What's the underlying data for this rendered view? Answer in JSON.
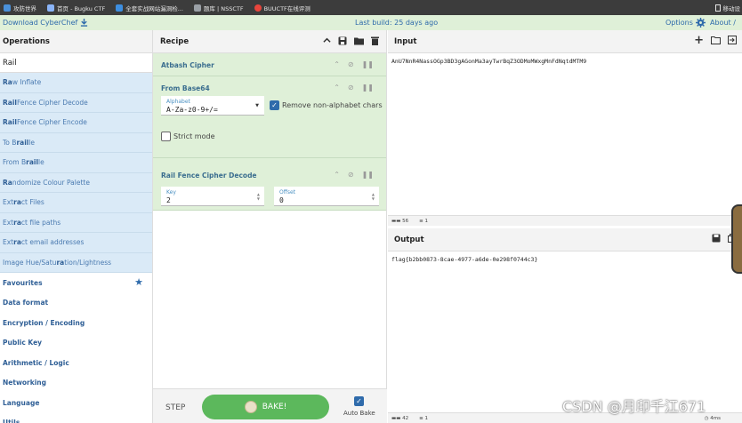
{
  "bookmarks": [
    {
      "label": "攻防世界",
      "icon": "globe-icon",
      "color": "#4a90d9"
    },
    {
      "label": "首页 - Bugku CTF",
      "icon": "globe-icon",
      "color": "#8ab4f8"
    },
    {
      "label": "全套实战网站漏洞检...",
      "icon": "cloud-icon",
      "color": "#3d8ee0"
    },
    {
      "label": "题库 | NSSCTF",
      "icon": "page-icon",
      "color": "#9aa0a6"
    },
    {
      "label": "BUUCTF在线评测",
      "icon": "bug-icon",
      "color": "#e8453c"
    }
  ],
  "bookmarks_right": "移动设",
  "banner": {
    "download": "Download CyberChef",
    "last_build": "Last build: 25 days ago",
    "options": "Options",
    "about": "About /"
  },
  "operations": {
    "title": "Operations",
    "search": "Rail",
    "results": [
      {
        "pre": "",
        "hl": "Ra",
        "post": "w Inflate"
      },
      {
        "pre": "",
        "hl": "Rail",
        "post": " Fence Cipher Decode"
      },
      {
        "pre": "",
        "hl": "Rail",
        "post": " Fence Cipher Encode"
      },
      {
        "pre": "To B",
        "hl": "rail",
        "post": "le"
      },
      {
        "pre": "From B",
        "hl": "rail",
        "post": "le"
      },
      {
        "pre": "",
        "hl": "Ra",
        "post": "ndomize Colour Palette"
      },
      {
        "pre": "Ext",
        "hl": "ra",
        "post": "ct Files"
      },
      {
        "pre": "Ext",
        "hl": "ra",
        "post": "ct file paths"
      },
      {
        "pre": "Ext",
        "hl": "ra",
        "post": "ct email addresses"
      },
      {
        "pre": "Image Hue/Satu",
        "hl": "ra",
        "post": "tion/Lightness"
      }
    ],
    "categories": [
      "Favourites",
      "Data format",
      "Encryption / Encoding",
      "Public Key",
      "Arithmetic / Logic",
      "Networking",
      "Language",
      "Utils"
    ]
  },
  "recipe": {
    "title": "Recipe",
    "atbash": {
      "title": "Atbash Cipher"
    },
    "base64": {
      "title": "From Base64",
      "alphabet_label": "Alphabet",
      "alphabet_value": "A-Za-z0-9+/=",
      "remove_label": "Remove non-alphabet chars",
      "strict_label": "Strict mode"
    },
    "railfence": {
      "title": "Rail Fence Cipher Decode",
      "key_label": "Key",
      "key_value": "2",
      "offset_label": "Offset",
      "offset_value": "0"
    },
    "step": "STEP",
    "bake": "BAKE!",
    "autobake": "Auto Bake"
  },
  "input": {
    "title": "Input",
    "text": "AnU7NnR4NassOGp3BD3gAGonMa3ayTwrBqZ3ODMoMWxgMnFdNqtdMTM9",
    "length_label": "56",
    "lines_label": "1"
  },
  "output": {
    "title": "Output",
    "text": "flag{b2bb0873-8cae-4977-a6de-0e298f0744c3}",
    "length_label": "42",
    "lines_label": "1",
    "time_label": "4ms"
  },
  "watermark": "CSDN @月印千江671",
  "colors": {
    "accent": "#2f6bab",
    "bake": "#5cb85c",
    "recipe_bg": "#dff0d8",
    "ops_bg": "#daeaf7"
  }
}
